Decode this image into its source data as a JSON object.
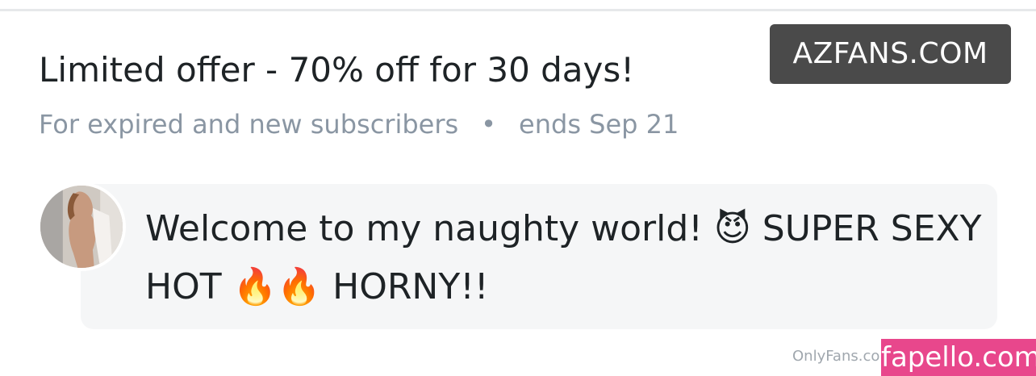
{
  "offer": {
    "title": "Limited offer - 70% off for 30 days!",
    "audience": "For expired and new subscribers",
    "separator": "•",
    "ends": "ends Sep 21"
  },
  "watermarks": {
    "azfans": "AZFANS.COM",
    "onlyfans": "OnlyFans.com",
    "fapello": "fapello.com"
  },
  "message": {
    "text": "Welcome to my naughty world! 😈 SUPER SEXY HOT 🔥🔥 HORNY!!"
  },
  "colors": {
    "title_text": "#1e2326",
    "muted_text": "#8a96a3",
    "bubble_bg": "#f5f6f7",
    "azfans_bg": "#4a4a4a",
    "fapello_bg": "#e8478c"
  },
  "avatar": {
    "alt": "creator avatar"
  }
}
